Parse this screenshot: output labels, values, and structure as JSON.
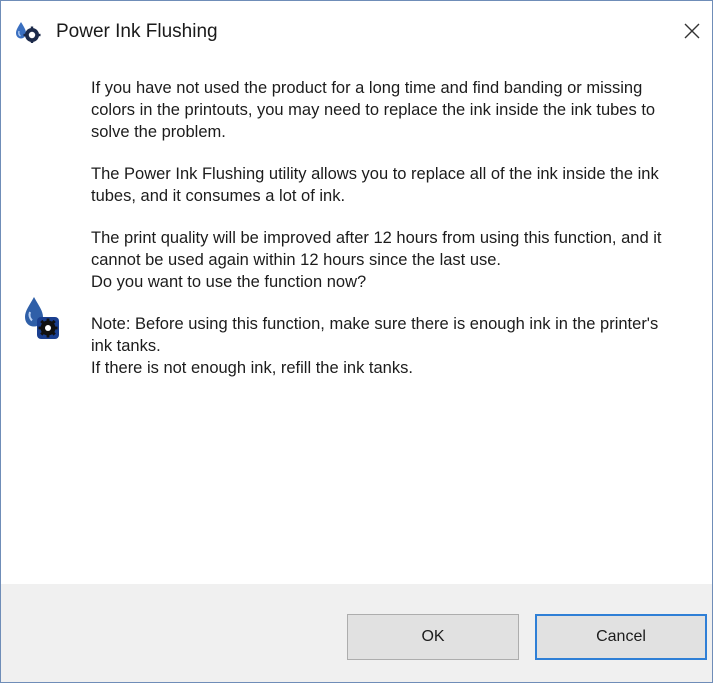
{
  "window": {
    "title": "Power Ink Flushing",
    "title_icon": "ink-drop-gear-icon",
    "close_icon": "close-icon"
  },
  "message": {
    "side_icon": "ink-drop-gear-icon",
    "paragraph1": "If you have not used the product for a long time and find banding or missing colors in the printouts, you may need to replace the ink inside the ink tubes to solve the problem.",
    "paragraph2": "The Power Ink Flushing utility allows you to replace all of the ink inside the ink tubes, and it consumes a lot of ink.",
    "paragraph3": "The print quality will be improved after 12 hours from using this function, and it cannot be used again within 12 hours since the last use.",
    "question": "Do you want to use the function now?",
    "note_line1": "Note: Before using this function, make sure there is enough ink in the printer's ink tanks.",
    "note_line2": "If there is not enough ink, refill the ink tanks."
  },
  "buttons": {
    "ok_label": "OK",
    "cancel_label": "Cancel"
  },
  "colors": {
    "window_border": "#6f8db8",
    "button_bar": "#f0f0f0",
    "button_face": "#e1e1e1",
    "focus_border": "#2f7fd6",
    "icon_blue": "#2f5fa8"
  }
}
